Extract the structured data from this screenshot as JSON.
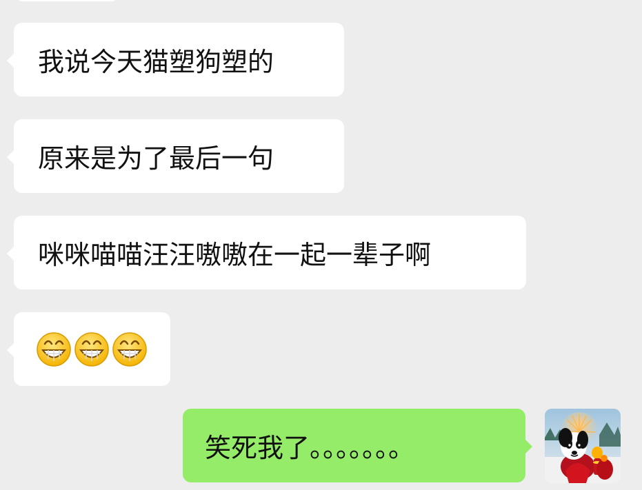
{
  "chat": {
    "messages": [
      {
        "sender": "incoming",
        "text": "我说今天猫塑狗塑的"
      },
      {
        "sender": "incoming",
        "text": "原来是为了最后一句"
      },
      {
        "sender": "incoming",
        "text": "咪咪喵喵汪汪嗷嗷在一起一辈子啊"
      },
      {
        "sender": "incoming",
        "emojis": [
          "grin-emoji",
          "grin-emoji",
          "grin-emoji"
        ]
      },
      {
        "sender": "outgoing",
        "text": "笑死我了。。。。。。。"
      }
    ]
  },
  "colors": {
    "background": "#ededed",
    "incoming_bubble": "#ffffff",
    "outgoing_bubble": "#95ec69",
    "text": "#111111"
  },
  "icons": {
    "emoji": "grin-emoji",
    "avatar": "dog-avatar"
  }
}
